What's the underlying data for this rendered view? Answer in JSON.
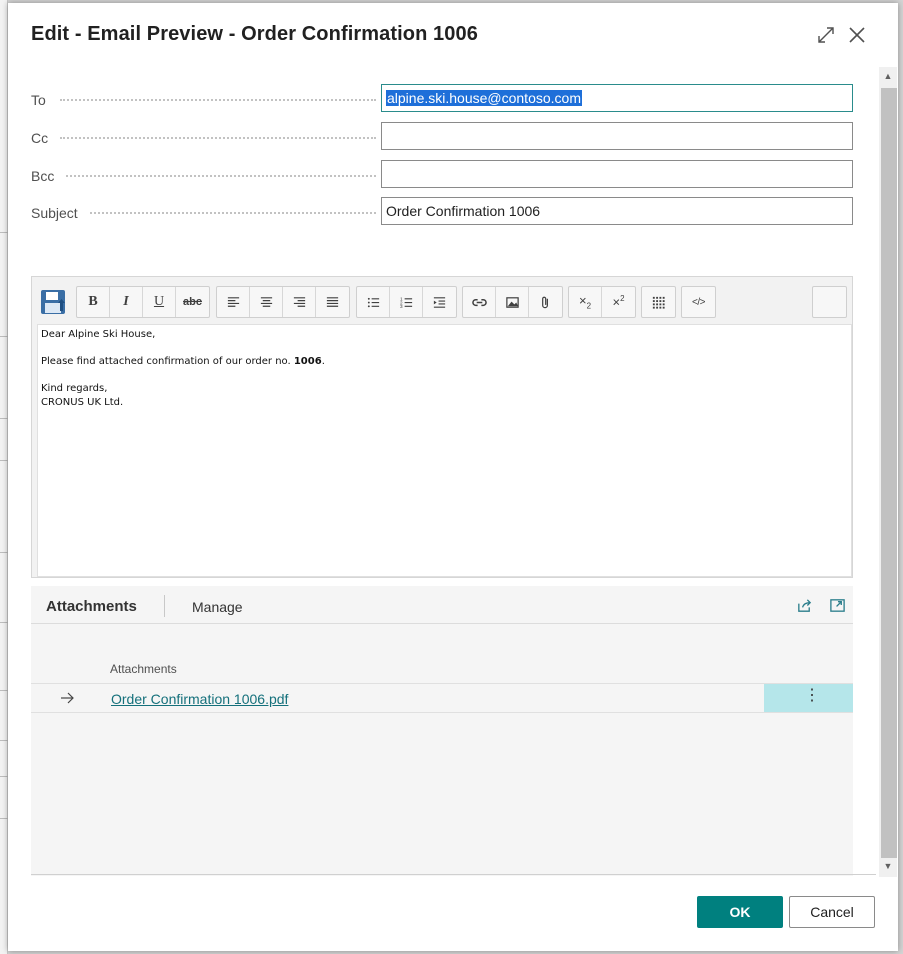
{
  "dialog": {
    "title": "Edit - Email Preview - Order Confirmation 1006"
  },
  "fields": {
    "to": {
      "label": "To",
      "value": "alpine.ski.house@contoso.com"
    },
    "cc": {
      "label": "Cc",
      "value": ""
    },
    "bcc": {
      "label": "Bcc",
      "value": ""
    },
    "subject": {
      "label": "Subject",
      "value": "Order Confirmation 1006"
    }
  },
  "toolbar": {
    "buttons": [
      "save",
      "bold",
      "italic",
      "underline",
      "strikethrough",
      "align-left",
      "align-center",
      "align-right",
      "justify",
      "bulleted-list",
      "numbered-list",
      "indent",
      "link",
      "image",
      "attachment",
      "subscript",
      "superscript",
      "table",
      "html-source"
    ]
  },
  "body": {
    "greeting": "Dear Alpine Ski House,",
    "line1_prefix": "Please find attached confirmation of our order no. ",
    "line1_order": "1006",
    "line1_suffix": ".",
    "closing": "Kind regards,",
    "company": "CRONUS UK Ltd."
  },
  "attachments": {
    "tab_title": "Attachments",
    "manage_label": "Manage",
    "column_header": "Attachments",
    "items": [
      {
        "name": "Order Confirmation 1006.pdf"
      }
    ]
  },
  "actions": {
    "ok_label": "OK",
    "cancel_label": "Cancel"
  },
  "colors": {
    "accent": "#00807f",
    "link": "#14707b",
    "selection": "#1e6fd9",
    "row_highlight": "#b5e6ea"
  }
}
